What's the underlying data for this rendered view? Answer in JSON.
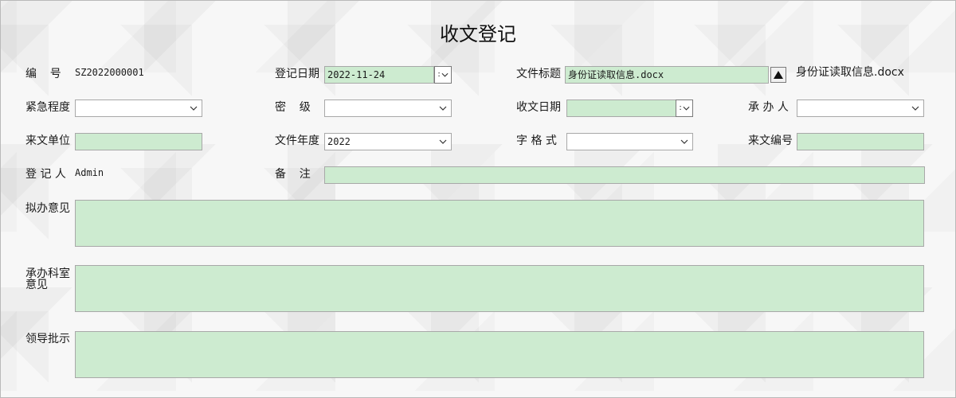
{
  "form": {
    "title": "收文登记",
    "number": {
      "label": "编　号",
      "value": "SZ2022000001"
    },
    "register_date": {
      "label": "登记日期",
      "value": "2022-11-24"
    },
    "file_title": {
      "label": "文件标题",
      "value": "身份证读取信息.docx",
      "display": "身份证读取信息.docx"
    },
    "urgency": {
      "label": "紧急程度",
      "value": ""
    },
    "secrecy": {
      "label": "密　级",
      "value": ""
    },
    "receive_date": {
      "label": "收文日期",
      "value": ""
    },
    "handler": {
      "label": "承 办 人",
      "value": ""
    },
    "source_unit": {
      "label": "来文单位",
      "value": ""
    },
    "file_year": {
      "label": "文件年度",
      "value": "2022"
    },
    "format": {
      "label": "字 格 式",
      "value": ""
    },
    "source_number": {
      "label": "来文编号",
      "value": ""
    },
    "registrar": {
      "label": "登 记 人",
      "value": "Admin"
    },
    "remark": {
      "label": "备　注",
      "value": ""
    },
    "draft_opinion": {
      "label": "拟办意见"
    },
    "dept_opinion": {
      "label_line1": "承办科室",
      "label_line2": "意见"
    },
    "leader_instruction": {
      "label": "领导批示"
    }
  },
  "icons": {
    "dropdown": "chevron-down-icon",
    "upload": "triangle-up-icon"
  },
  "colors": {
    "field_bg": "#cdebd0",
    "border": "#a8a8a8"
  }
}
